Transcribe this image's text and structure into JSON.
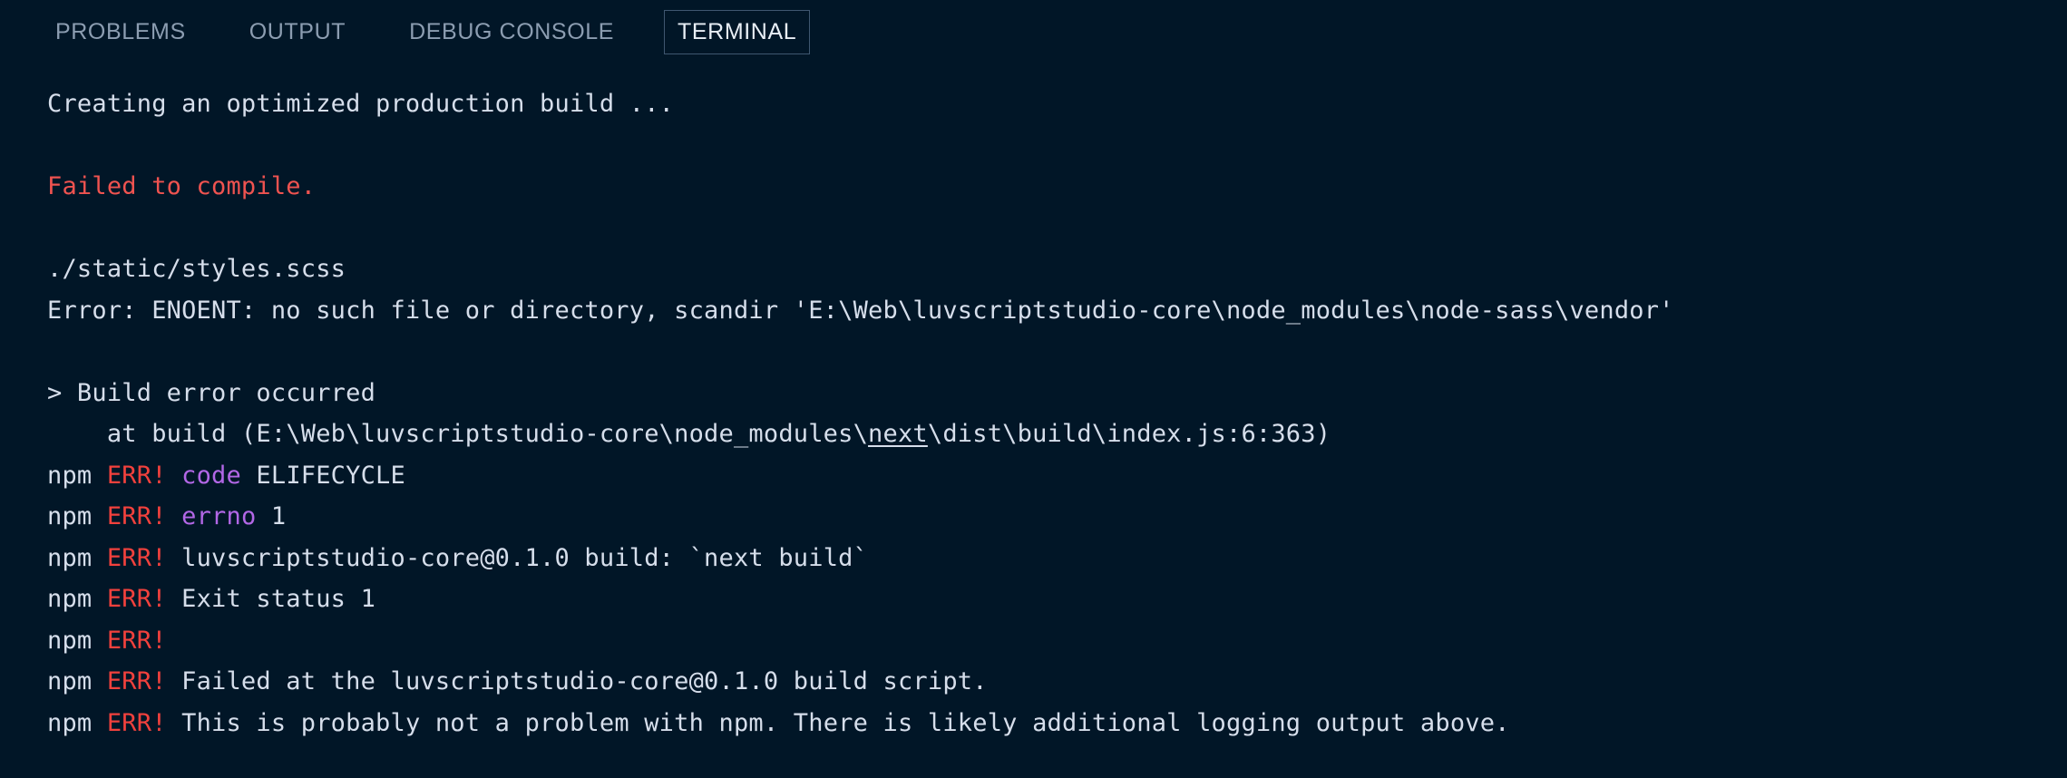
{
  "window": {
    "title": "TERMINAL",
    "background_color": "#011627",
    "foreground_color": "#d6deeb"
  },
  "tabs": [
    {
      "label": "PROBLEMS",
      "active": false
    },
    {
      "label": "OUTPUT",
      "active": false
    },
    {
      "label": "DEBUG CONSOLE",
      "active": false
    },
    {
      "label": "TERMINAL",
      "active": true
    }
  ],
  "colors": {
    "background": "#011627",
    "text": "#d6deeb",
    "tab_inactive": "#8c9db1",
    "tab_active": "#e8eef5",
    "tab_active_border": "#3f5770",
    "error_red": "#ef5350",
    "err_bang_red": "#f2413d",
    "magenta": "#b267e6"
  },
  "terminal": {
    "lines": [
      {
        "id": "line-creating-build",
        "segments": [
          {
            "text": "Creating an optimized production build ...",
            "color": "white"
          }
        ]
      },
      {
        "id": "line-blank-1",
        "segments": [
          {
            "text": " ",
            "color": "white"
          }
        ]
      },
      {
        "id": "line-failed-to-compile",
        "segments": [
          {
            "text": "Failed to compile.",
            "color": "red"
          }
        ]
      },
      {
        "id": "line-blank-2",
        "segments": [
          {
            "text": " ",
            "color": "white"
          }
        ]
      },
      {
        "id": "line-scss-file",
        "segments": [
          {
            "text": "./static/styles.scss",
            "color": "white"
          }
        ]
      },
      {
        "id": "line-enoent-error",
        "segments": [
          {
            "text": "Error: ENOENT: no such file or directory, scandir 'E:\\Web\\luvscriptstudio-core\\node_modules\\node-sass\\vendor'",
            "color": "white"
          }
        ]
      },
      {
        "id": "line-blank-3",
        "segments": [
          {
            "text": " ",
            "color": "white"
          }
        ]
      },
      {
        "id": "line-build-error-occurred",
        "segments": [
          {
            "text": "> Build error occurred",
            "color": "white"
          }
        ]
      },
      {
        "id": "line-stack-at-build",
        "segments": [
          {
            "text": "    at build (E:\\Web\\luvscriptstudio-core\\node_modules\\",
            "color": "white"
          },
          {
            "text": "next",
            "color": "white",
            "underline": true
          },
          {
            "text": "\\dist\\build\\index.js:6:363)",
            "color": "white"
          }
        ]
      },
      {
        "id": "line-npm-code",
        "segments": [
          {
            "text": "npm ",
            "color": "white"
          },
          {
            "text": "ERR!",
            "color": "errbang"
          },
          {
            "text": " ",
            "color": "white"
          },
          {
            "text": "code",
            "color": "magenta"
          },
          {
            "text": " ELIFECYCLE",
            "color": "white"
          }
        ]
      },
      {
        "id": "line-npm-errno",
        "segments": [
          {
            "text": "npm ",
            "color": "white"
          },
          {
            "text": "ERR!",
            "color": "errbang"
          },
          {
            "text": " ",
            "color": "white"
          },
          {
            "text": "errno",
            "color": "magenta"
          },
          {
            "text": " 1",
            "color": "white"
          }
        ]
      },
      {
        "id": "line-npm-build-script",
        "segments": [
          {
            "text": "npm ",
            "color": "white"
          },
          {
            "text": "ERR!",
            "color": "errbang"
          },
          {
            "text": " luvscriptstudio-core@0.1.0 build: `next build`",
            "color": "white"
          }
        ]
      },
      {
        "id": "line-npm-exit-status",
        "segments": [
          {
            "text": "npm ",
            "color": "white"
          },
          {
            "text": "ERR!",
            "color": "errbang"
          },
          {
            "text": " Exit status 1",
            "color": "white"
          }
        ]
      },
      {
        "id": "line-npm-empty",
        "segments": [
          {
            "text": "npm ",
            "color": "white"
          },
          {
            "text": "ERR!",
            "color": "errbang"
          }
        ]
      },
      {
        "id": "line-npm-failed-at",
        "segments": [
          {
            "text": "npm ",
            "color": "white"
          },
          {
            "text": "ERR!",
            "color": "errbang"
          },
          {
            "text": " Failed at the luvscriptstudio-core@0.1.0 build script.",
            "color": "white"
          }
        ]
      },
      {
        "id": "line-npm-probably-not",
        "segments": [
          {
            "text": "npm ",
            "color": "white"
          },
          {
            "text": "ERR!",
            "color": "errbang"
          },
          {
            "text": " This is probably not a problem with npm. There is likely additional logging output above.",
            "color": "white"
          }
        ]
      }
    ]
  }
}
